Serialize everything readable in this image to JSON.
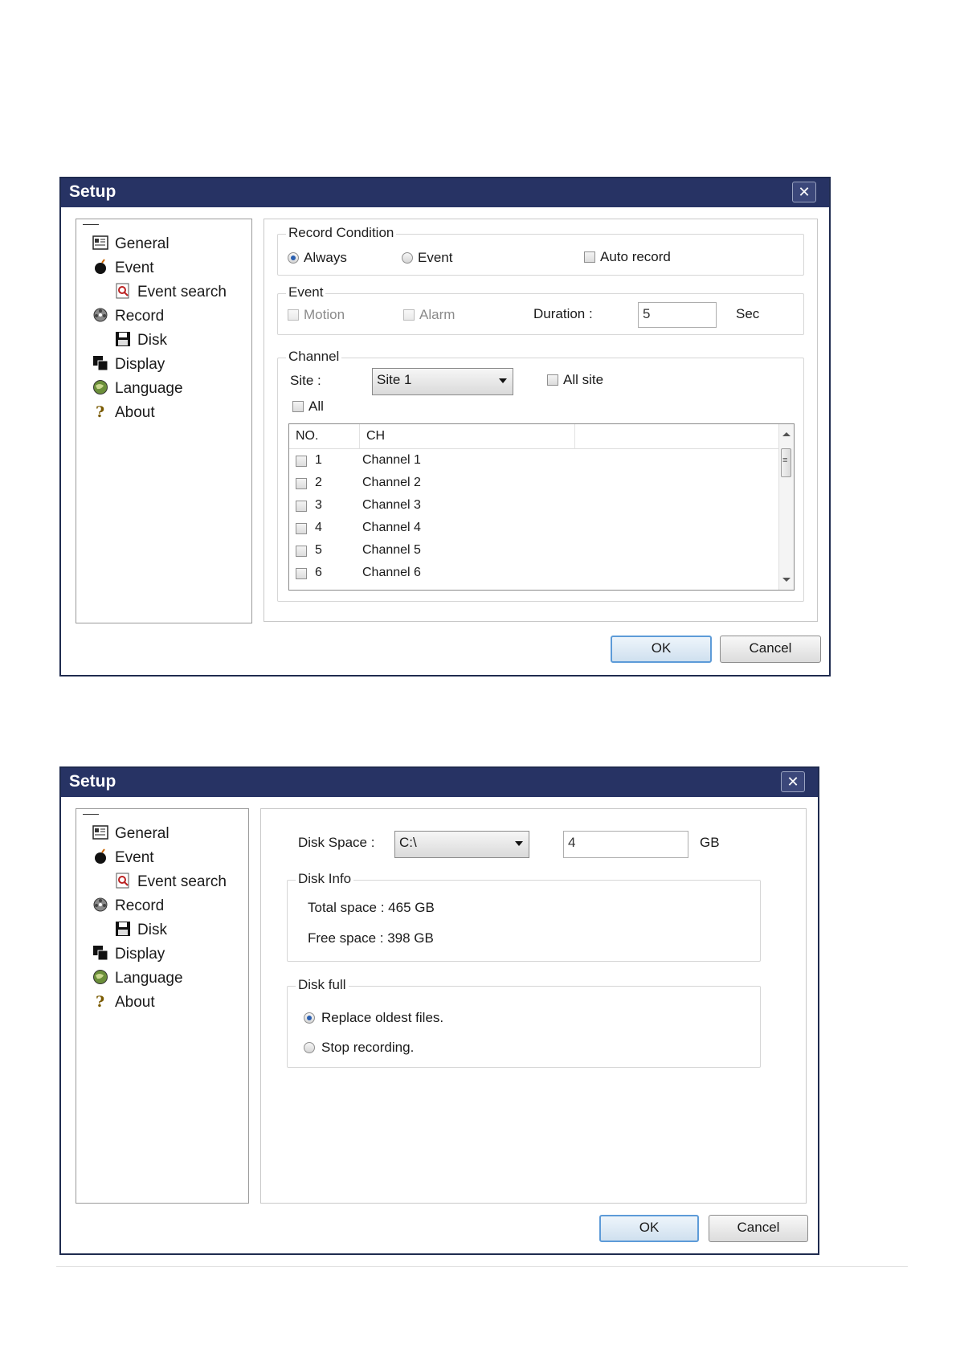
{
  "dialog1": {
    "title": "Setup",
    "close": "✕",
    "nav": [
      {
        "label": "General",
        "icon": "general-icon"
      },
      {
        "label": "Event",
        "icon": "event-bomb-icon"
      },
      {
        "label": "Event search",
        "icon": "event-search-icon"
      },
      {
        "label": "Record",
        "icon": "record-film-icon"
      },
      {
        "label": "Disk",
        "icon": "disk-floppy-icon"
      },
      {
        "label": "Display",
        "icon": "display-icon"
      },
      {
        "label": "Language",
        "icon": "language-globe-icon"
      },
      {
        "label": "About",
        "icon": "about-question-icon"
      }
    ],
    "record_condition": {
      "label": "Record Condition",
      "always": "Always",
      "event": "Event",
      "auto_record": "Auto record",
      "selected": "Always"
    },
    "event": {
      "label": "Event",
      "motion": "Motion",
      "alarm": "Alarm",
      "duration_label": "Duration :",
      "duration_value": "5",
      "unit": "Sec"
    },
    "channel": {
      "label": "Channel",
      "site_label": "Site :",
      "site_value": "Site 1",
      "all_site": "All site",
      "all": "All",
      "columns": [
        "NO.",
        "CH"
      ],
      "rows": [
        {
          "no": "1",
          "ch": "Channel 1"
        },
        {
          "no": "2",
          "ch": "Channel 2"
        },
        {
          "no": "3",
          "ch": "Channel 3"
        },
        {
          "no": "4",
          "ch": "Channel 4"
        },
        {
          "no": "5",
          "ch": "Channel 5"
        },
        {
          "no": "6",
          "ch": "Channel 6"
        }
      ]
    },
    "ok": "OK",
    "cancel": "Cancel"
  },
  "dialog2": {
    "title": "Setup",
    "close": "✕",
    "nav": [
      {
        "label": "General",
        "icon": "general-icon"
      },
      {
        "label": "Event",
        "icon": "event-bomb-icon"
      },
      {
        "label": "Event search",
        "icon": "event-search-icon"
      },
      {
        "label": "Record",
        "icon": "record-film-icon"
      },
      {
        "label": "Disk",
        "icon": "disk-floppy-icon"
      },
      {
        "label": "Display",
        "icon": "display-icon"
      },
      {
        "label": "Language",
        "icon": "language-globe-icon"
      },
      {
        "label": "About",
        "icon": "about-question-icon"
      }
    ],
    "disk_space_label": "Disk Space :",
    "disk_value": "C:\\",
    "size_value": "4",
    "size_unit": "GB",
    "disk_info": {
      "label": "Disk Info",
      "total": "Total space : 465 GB",
      "free": "Free space : 398 GB"
    },
    "disk_full": {
      "label": "Disk full",
      "replace": "Replace oldest files.",
      "stop": "Stop recording.",
      "selected": "Replace oldest files."
    },
    "ok": "OK",
    "cancel": "Cancel"
  },
  "colors": {
    "titlebar": "#273364",
    "default_button_border": "#5d9bd8",
    "radio_dot": "#2a5fb0"
  }
}
